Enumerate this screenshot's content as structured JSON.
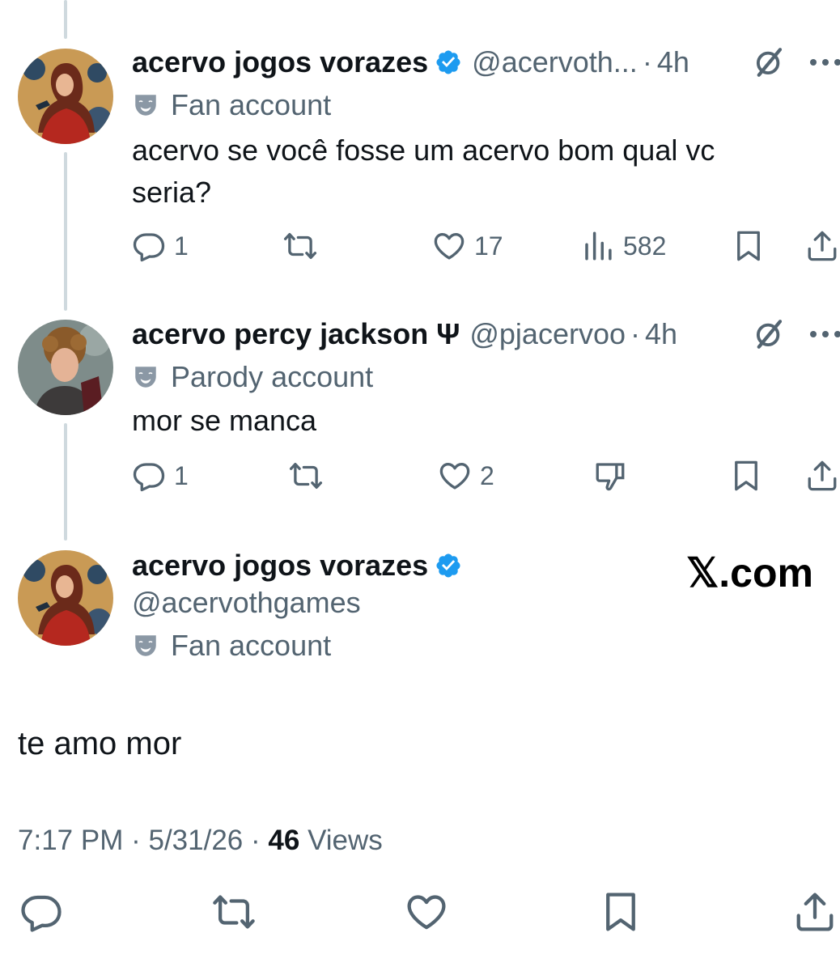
{
  "tweets": [
    {
      "name": "acervo jogos vorazes",
      "handle": "@acervoth...",
      "time": "4h",
      "label": "Fan account",
      "text": "acervo se você fosse um acervo bom qual vc\nseria?",
      "replies": "1",
      "likes": "17",
      "views": "582"
    },
    {
      "name": "acervo percy jackson Ψ",
      "handle": "@pjacervoo",
      "time": "4h",
      "label": "Parody account",
      "text": "mor se manca",
      "replies": "1",
      "likes": "2"
    }
  ],
  "main": {
    "name": "acervo jogos vorazes",
    "handle": "@acervothgames",
    "label": "Fan account",
    "text": "te amo mor",
    "time": "7:17 PM",
    "date": "5/31/26",
    "views_count": "46",
    "views_label": "Views"
  },
  "watermark": "𝕏.com",
  "separator": "·",
  "icons": [
    "verified-badge-icon",
    "grok-icon",
    "more-icon",
    "comedy-mask-icon",
    "reply-icon",
    "repost-icon",
    "like-icon",
    "views-icon",
    "downvote-icon",
    "bookmark-icon",
    "share-icon"
  ],
  "colors": {
    "text": "#0f1419",
    "secondary": "#536471",
    "verified": "#1d9bf0",
    "thread_line": "#cfd9de"
  }
}
